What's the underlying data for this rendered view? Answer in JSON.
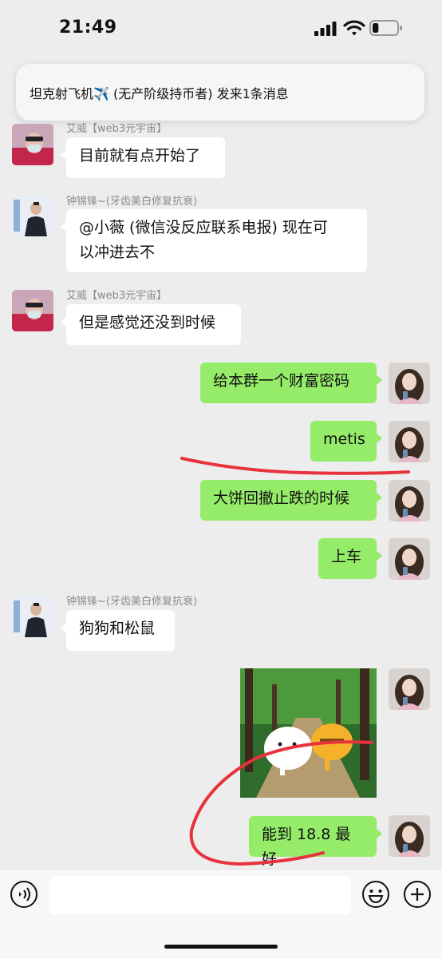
{
  "status_bar": {
    "time": "21:49",
    "battery_level": 0.25
  },
  "notification": {
    "text": "坦克射飞机✈️ (无产阶级持币者) 发来1条消息"
  },
  "messages": [
    {
      "sender": "艾威【web3元宇宙】",
      "text": "目前就有点开始了"
    },
    {
      "sender": "钟锦锋~(牙齿美白修复抗衰)",
      "line1": "@小薇 (微信没反应联系电报) 现在可",
      "line2": "以冲进去不"
    },
    {
      "sender": "艾威【web3元宇宙】",
      "text": "但是感觉还没到时候"
    },
    {
      "text": "给本群一个财富密码"
    },
    {
      "text": "metis"
    },
    {
      "text": "大饼回撤止跌的时候"
    },
    {
      "text": "上车"
    },
    {
      "sender": "钟锦锋~(牙齿美白修复抗衰)",
      "text": "狗狗和松鼠"
    },
    {
      "text": "能到 18.8 最好"
    }
  ],
  "colors": {
    "outgoing_bubble": "#95ec69",
    "incoming_bubble": "#ffffff",
    "background": "#ededed",
    "annotation": "#e8323c"
  },
  "input_bar": {
    "placeholder": "",
    "icons": [
      "voice-icon",
      "emoji-icon",
      "plus-icon"
    ]
  }
}
